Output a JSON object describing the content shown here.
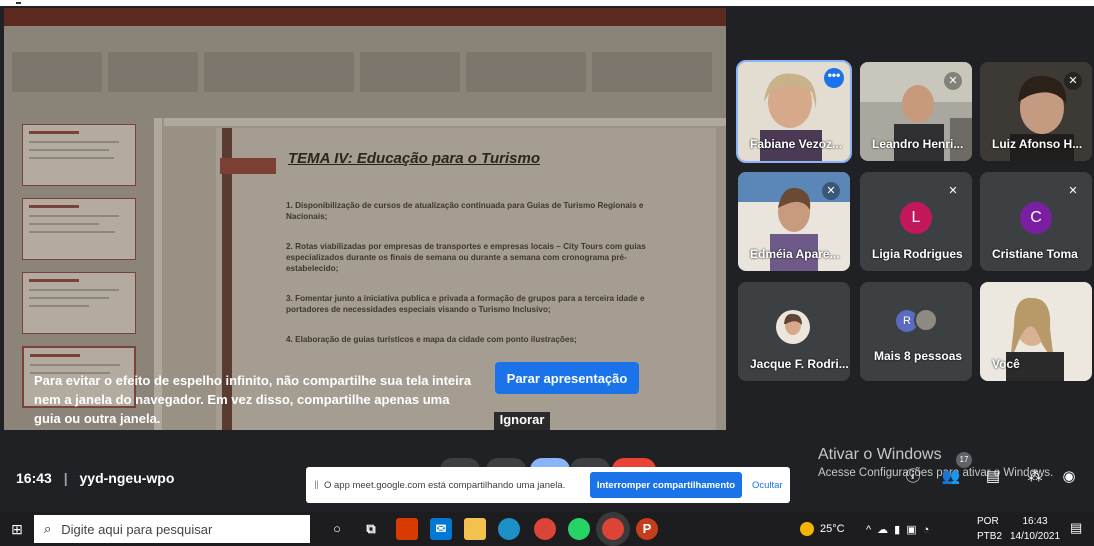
{
  "meeting": {
    "time": "16:43",
    "code": "yyd-ngeu-wpo"
  },
  "presentation": {
    "slide_title": "TEMA IV: Educação para o Turismo",
    "items": [
      "1. Disponibilização de cursos de atualização continuada para Guias de Turismo Regionais e Nacionais;",
      "2. Rotas viabilizadas por empresas de transportes e empresas locais – City Tours com guias especializados durante os finais de semana ou durante a semana com cronograma pré-estabelecido;",
      "3. Fomentar junto a iniciativa publica e privada a formação de grupos para a terceira idade e portadores de necessidades especiais visando o Turismo Inclusivo;",
      "4. Elaboração de guias turísticos e mapa da cidade com ponto ilustrações;"
    ]
  },
  "overlay": {
    "warning": "Para evitar o efeito de espelho infinito, não compartilhe sua tela inteira nem a janela do navegador. Em vez disso, compartilhe apenas uma guia ou outra janela.",
    "stop_button": "Parar apresentação",
    "ignore_button": "Ignorar"
  },
  "participants": [
    {
      "name": "Fabiane Vezoz...",
      "kind": "video",
      "speaking": true
    },
    {
      "name": "Leandro Henri...",
      "kind": "video",
      "muted": true
    },
    {
      "name": "Luiz Afonso H...",
      "kind": "video",
      "muted": true
    },
    {
      "name": "Edméia Apare...",
      "kind": "video",
      "muted": true
    },
    {
      "name": "Ligia Rodrigues",
      "kind": "avatar",
      "initial": "L",
      "color": "#c2185b",
      "muted": true
    },
    {
      "name": "Cristiane Toma",
      "kind": "avatar",
      "initial": "C",
      "color": "#7b1fa2",
      "muted": true
    },
    {
      "name": "Jacque F. Rodri...",
      "kind": "photo"
    },
    {
      "name": "Mais 8 pessoas",
      "kind": "group",
      "initial": "R"
    },
    {
      "name": "Você",
      "kind": "video"
    }
  ],
  "share_bar": {
    "message": "O app meet.google.com está compartilhando uma janela.",
    "stop_label": "Interromper compartilhamento",
    "hide_label": "Ocultar"
  },
  "windows_activation": {
    "title": "Ativar o Windows",
    "subtitle": "Acesse Configurações para ativar o Windows."
  },
  "people_badge": "17",
  "taskbar": {
    "search_placeholder": "Digite aqui para pesquisar",
    "weather": "25°C",
    "lang_top": "POR",
    "lang_bottom": "PTB2",
    "clock_time": "16:43",
    "clock_date": "14/10/2021"
  },
  "icons": [
    "windows-start-icon",
    "search-icon",
    "cortana-icon",
    "task-view-icon",
    "office-icon",
    "mail-icon",
    "file-explorer-icon",
    "edge-icon",
    "chrome-icon",
    "whatsapp-icon",
    "chrome-icon-2",
    "powerpoint-icon",
    "mic-off-icon",
    "more-options-icon",
    "info-icon",
    "people-icon",
    "chat-icon",
    "activities-icon",
    "host-controls-icon",
    "notification-icon"
  ]
}
